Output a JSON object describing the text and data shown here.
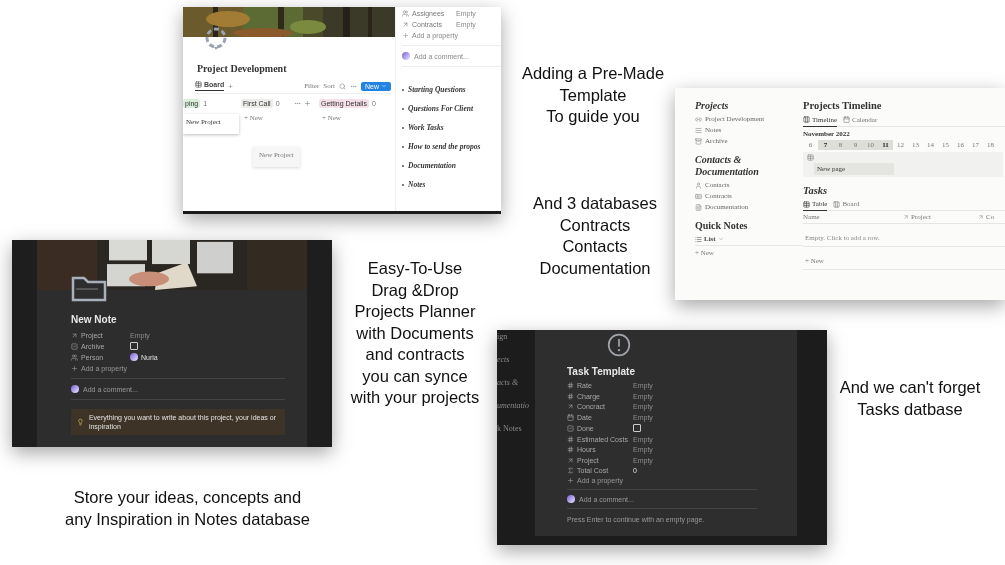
{
  "template_page": {
    "title": "Project Development",
    "view_tab": {
      "label": "Board",
      "selected": true
    },
    "add_view": "+",
    "toolbar": [
      "Filter",
      "Sort"
    ],
    "new_button": "New",
    "groups": [
      {
        "label": "ping",
        "count": "1",
        "color": "#dbeddb",
        "cards": [
          "New Project"
        ]
      },
      {
        "label": "First Call",
        "count": "0",
        "color": "#ececea",
        "add": "+ New"
      },
      {
        "label": "Getting Details",
        "count": "0",
        "color": "#f5dfe8",
        "add": "+ New"
      }
    ],
    "dragged_card": "New Project",
    "properties": [
      {
        "kind": "person",
        "name": "Assignees",
        "value": "Empty"
      },
      {
        "kind": "relation",
        "name": "Contracts",
        "value": "Empty"
      }
    ],
    "add_property": "Add a property",
    "comment": "Add a comment...",
    "sections": [
      "Starting Questions",
      "Questions For Client",
      "Work Tasks",
      "How to send the propos",
      "Documentation",
      "Notes"
    ]
  },
  "captions": [
    "Adding a Pre-Made\nTemplate\nTo guide you",
    "And 3 databases\nContracts\nContacts\nDocumentation",
    "Easy-To-Use\nDrag &Drop\nProjects Planner\nwith Documents\nand contracts\nyou can synce\nwith your projects",
    "And we can't forget\nTasks datbase",
    "Store your ideas, concepts and\nany Inspiration in Notes database"
  ],
  "workspace": {
    "sidebar": [
      {
        "title": "Projects",
        "italic": true,
        "items": [
          {
            "kind": "project",
            "label": "Project Development"
          },
          {
            "kind": "list",
            "label": "Notes"
          },
          {
            "kind": "archive",
            "label": "Archive"
          }
        ]
      },
      {
        "title": "Contacts &\nDocumentation",
        "italic": true,
        "items": [
          {
            "kind": "contact",
            "label": "Contacts"
          },
          {
            "kind": "card",
            "label": "Contracts"
          },
          {
            "kind": "doc",
            "label": "Documentation"
          }
        ]
      },
      {
        "title": "Quick Notes",
        "italic": false,
        "view": "List",
        "add": "+ New"
      }
    ],
    "timeline": {
      "title": "Projects Timeline",
      "tabs": [
        {
          "label": "Timeline",
          "selected": true
        },
        {
          "label": "Calendar",
          "selected": false
        }
      ],
      "month": "November 2022",
      "days": [
        {
          "label": "6",
          "in_range": false,
          "bold": false
        },
        {
          "label": "7",
          "in_range": true,
          "bold": true
        },
        {
          "label": "8",
          "in_range": true,
          "bold": false
        },
        {
          "label": "9",
          "in_range": true,
          "bold": false
        },
        {
          "label": "10",
          "in_range": true,
          "bold": false
        },
        {
          "label": "11",
          "in_range": true,
          "bold": true
        },
        {
          "label": "12",
          "in_range": false,
          "bold": false
        },
        {
          "label": "13",
          "in_range": false,
          "bold": false
        },
        {
          "label": "14",
          "in_range": false,
          "bold": false
        },
        {
          "label": "15",
          "in_range": false,
          "bold": false
        },
        {
          "label": "16",
          "in_range": false,
          "bold": false
        },
        {
          "label": "17",
          "in_range": false,
          "bold": false
        },
        {
          "label": "18",
          "in_range": false,
          "bold": false
        }
      ],
      "item": "New page"
    },
    "tasks": {
      "title": "Tasks",
      "tabs": [
        {
          "label": "Table",
          "selected": true
        },
        {
          "label": "Board",
          "selected": false
        }
      ],
      "columns": [
        "Name",
        "Project",
        "Co"
      ],
      "empty": "Empty. Click to add a row.",
      "add": "+ New"
    }
  },
  "note_page": {
    "title": "New Note",
    "properties": [
      {
        "kind": "relation",
        "name": "Project",
        "value": "Empty"
      },
      {
        "kind": "checkbox",
        "name": "Archive",
        "checked": false
      },
      {
        "kind": "person",
        "name": "Person",
        "value": "Nuria"
      }
    ],
    "add_property": "Add a property",
    "comment": "Add a comment...",
    "callout": "Everything you want to write about this project, your ideas or inspiration"
  },
  "task_page": {
    "background_sidebar": [
      "ign",
      "ects",
      "acts &",
      "umentatio",
      "k Notes"
    ],
    "title": "Task Template",
    "properties": [
      {
        "kind": "number",
        "name": "Rate",
        "value": "Empty"
      },
      {
        "kind": "number",
        "name": "Charge",
        "value": "Empty"
      },
      {
        "kind": "relation",
        "name": "Concract",
        "value": "Empty"
      },
      {
        "kind": "date",
        "name": "Date",
        "value": "Empty"
      },
      {
        "kind": "checkbox",
        "name": "Done",
        "checked": false
      },
      {
        "kind": "number",
        "name": "Estimated Costs",
        "value": "Empty"
      },
      {
        "kind": "number",
        "name": "Hours",
        "value": "Empty"
      },
      {
        "kind": "relation",
        "name": "Project",
        "value": "Empty"
      },
      {
        "kind": "formula",
        "name": "Total Cost",
        "value": "0"
      }
    ],
    "add_property": "Add a property",
    "comment": "Add a comment...",
    "hint": "Press Enter to continue with an empty page."
  }
}
